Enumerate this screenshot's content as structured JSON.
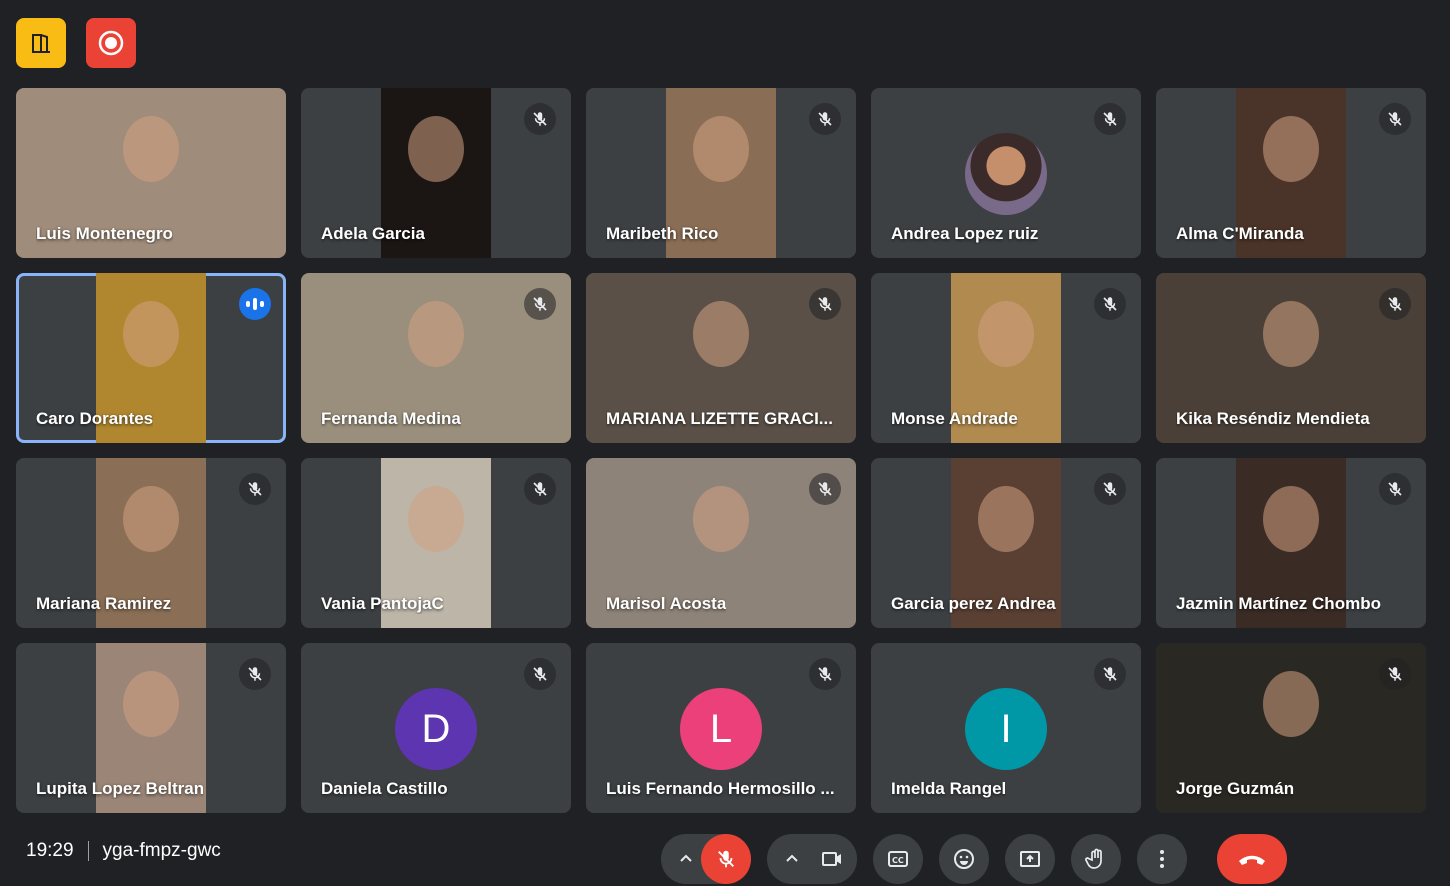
{
  "top_badges": [
    {
      "name": "door-icon",
      "color": "#f9bc15"
    },
    {
      "name": "record-icon",
      "color": "#ea4335"
    }
  ],
  "participants": [
    {
      "name": "Luis Montenegro",
      "type": "video-wide",
      "muted": false,
      "bg": "#a08c7a"
    },
    {
      "name": "Adela Garcia",
      "type": "video",
      "muted": true,
      "bg": "#1b1513"
    },
    {
      "name": "Maribeth Rico",
      "type": "video",
      "muted": true,
      "bg": "#8a6d55"
    },
    {
      "name": "Andrea Lopez ruiz",
      "type": "photo-avatar",
      "muted": true
    },
    {
      "name": "Alma C'Miranda",
      "type": "video",
      "muted": true,
      "bg": "#4a3328"
    },
    {
      "name": "Caro Dorantes",
      "type": "video",
      "muted": false,
      "speaking": true,
      "active": true,
      "bg": "#b0872f"
    },
    {
      "name": "Fernanda Medina",
      "type": "video-wide",
      "muted": true,
      "bg": "#9a8f7c"
    },
    {
      "name": "MARIANA LIZETTE GRACI...",
      "type": "video-wide",
      "muted": true,
      "bg": "#5a5048"
    },
    {
      "name": "Monse Andrade",
      "type": "video",
      "muted": true,
      "bg": "#b08a4e"
    },
    {
      "name": "Kika Reséndiz Mendieta",
      "type": "video-wide",
      "muted": true,
      "bg": "#4b4038"
    },
    {
      "name": "Mariana Ramirez",
      "type": "video",
      "muted": true,
      "bg": "#8a6e55"
    },
    {
      "name": "Vania PantojaC",
      "type": "video",
      "muted": true,
      "bg": "#bcb5a8"
    },
    {
      "name": "Marisol Acosta",
      "type": "video-wide",
      "muted": true,
      "bg": "#8e8378"
    },
    {
      "name": "Garcia perez Andrea",
      "type": "video",
      "muted": true,
      "bg": "#5a3f33"
    },
    {
      "name": "Jazmin Martínez Chombo",
      "type": "video",
      "muted": true,
      "bg": "#3a2b25"
    },
    {
      "name": "Lupita Lopez Beltran",
      "type": "video",
      "muted": true,
      "bg": "#9a8576"
    },
    {
      "name": "Daniela Castillo",
      "type": "letter",
      "letter": "D",
      "color": "#5e35b1",
      "muted": true
    },
    {
      "name": "Luis Fernando Hermosillo ...",
      "type": "letter",
      "letter": "L",
      "color": "#ec407a",
      "muted": true
    },
    {
      "name": "Imelda Rangel",
      "type": "letter",
      "letter": "I",
      "color": "#0097a7",
      "muted": true
    },
    {
      "name": "Jorge Guzmán",
      "type": "video-wide",
      "muted": true,
      "bg": "#2a2822"
    }
  ],
  "meeting": {
    "time": "19:29",
    "code": "yga-fmpz-gwc"
  },
  "controls": [
    {
      "name": "mic-options-chevron-icon"
    },
    {
      "name": "microphone-off-icon",
      "state": "off"
    },
    {
      "name": "camera-options-chevron-icon"
    },
    {
      "name": "camera-icon"
    },
    {
      "name": "captions-icon"
    },
    {
      "name": "emoji-icon"
    },
    {
      "name": "present-screen-icon"
    },
    {
      "name": "raise-hand-icon"
    },
    {
      "name": "more-options-icon"
    },
    {
      "name": "hang-up-icon"
    }
  ],
  "colors": {
    "background": "#202124",
    "tile": "#3c4043",
    "accent": "#8ab4f8",
    "danger": "#ea4335"
  }
}
